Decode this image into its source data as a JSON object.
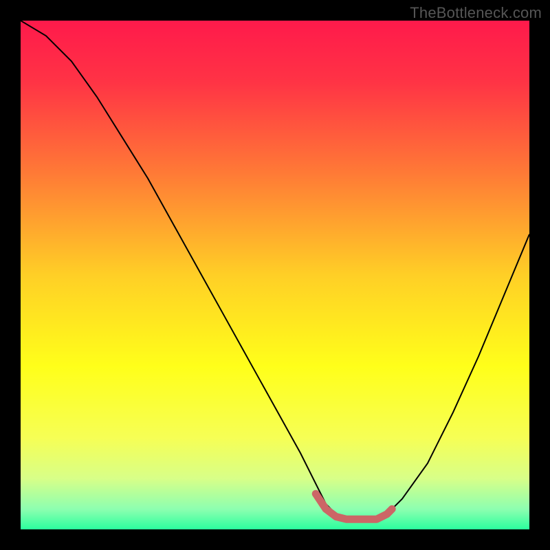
{
  "watermark": "TheBottleneck.com",
  "colors": {
    "background": "#000000",
    "gradient_stops": [
      {
        "offset": 0.0,
        "color": "#ff1a4b"
      },
      {
        "offset": 0.12,
        "color": "#ff3345"
      },
      {
        "offset": 0.3,
        "color": "#ff7a36"
      },
      {
        "offset": 0.5,
        "color": "#ffcf26"
      },
      {
        "offset": 0.68,
        "color": "#ffff1a"
      },
      {
        "offset": 0.82,
        "color": "#f6ff55"
      },
      {
        "offset": 0.9,
        "color": "#d8ff88"
      },
      {
        "offset": 0.96,
        "color": "#8dffb0"
      },
      {
        "offset": 1.0,
        "color": "#2bff9e"
      }
    ],
    "curve": "#000000",
    "marker": "#cc6666"
  },
  "chart_data": {
    "type": "line",
    "title": "",
    "xlabel": "",
    "ylabel": "",
    "xlim": [
      0,
      100
    ],
    "ylim": [
      0,
      100
    ],
    "grid": false,
    "legend": false,
    "series": [
      {
        "name": "curve",
        "x": [
          0,
          5,
          10,
          15,
          20,
          25,
          30,
          35,
          40,
          45,
          50,
          55,
          58,
          60,
          62,
          64,
          66,
          68,
          70,
          72,
          75,
          80,
          85,
          90,
          95,
          100
        ],
        "y": [
          100,
          97,
          92,
          85,
          77,
          69,
          60,
          51,
          42,
          33,
          24,
          15,
          9,
          5,
          3,
          2,
          2,
          2,
          2,
          3,
          6,
          13,
          23,
          34,
          46,
          58
        ]
      }
    ],
    "markers": {
      "name": "highlighted-region",
      "x": [
        58,
        60,
        62,
        64,
        66,
        68,
        70,
        72,
        73
      ],
      "y": [
        7,
        4,
        2.5,
        2,
        2,
        2,
        2,
        3,
        4
      ]
    }
  }
}
